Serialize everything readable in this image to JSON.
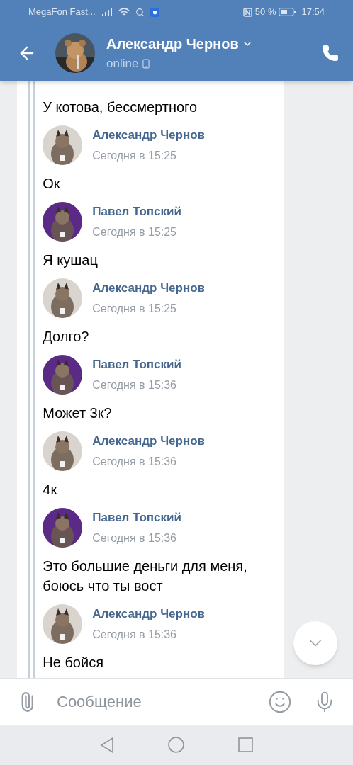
{
  "status_bar": {
    "carrier": "MegaFon Fast...",
    "battery": "50 %",
    "time": "17:54"
  },
  "header": {
    "name": "Александр Чернов",
    "status": "online"
  },
  "messages": [
    {
      "text": "У котова, бессмертного"
    },
    {
      "sender": "Александр Чернов",
      "time": "Сегодня в 15:25",
      "color": "#d9d4ce",
      "text": "Ок"
    },
    {
      "sender": "Павел Топский",
      "time": "Сегодня в 15:25",
      "color": "#5b2a86",
      "text": "Я кушац"
    },
    {
      "sender": "Александр Чернов",
      "time": "Сегодня в 15:25",
      "color": "#d9d4ce",
      "text": "Долго?"
    },
    {
      "sender": "Павел Топский",
      "time": "Сегодня в 15:36",
      "color": "#5b2a86",
      "text": "Может 3к?"
    },
    {
      "sender": "Александр Чернов",
      "time": "Сегодня в 15:36",
      "color": "#d9d4ce",
      "text": "4к"
    },
    {
      "sender": "Павел Топский",
      "time": "Сегодня в 15:36",
      "color": "#5b2a86",
      "text": "Это большие деньги для меня, боюсь что ты вост"
    },
    {
      "sender": "Александр Чернов",
      "time": "Сегодня в 15:36",
      "color": "#d9d4ce",
      "text": "Не бойся"
    }
  ],
  "composer": {
    "placeholder": "Сообщение"
  }
}
